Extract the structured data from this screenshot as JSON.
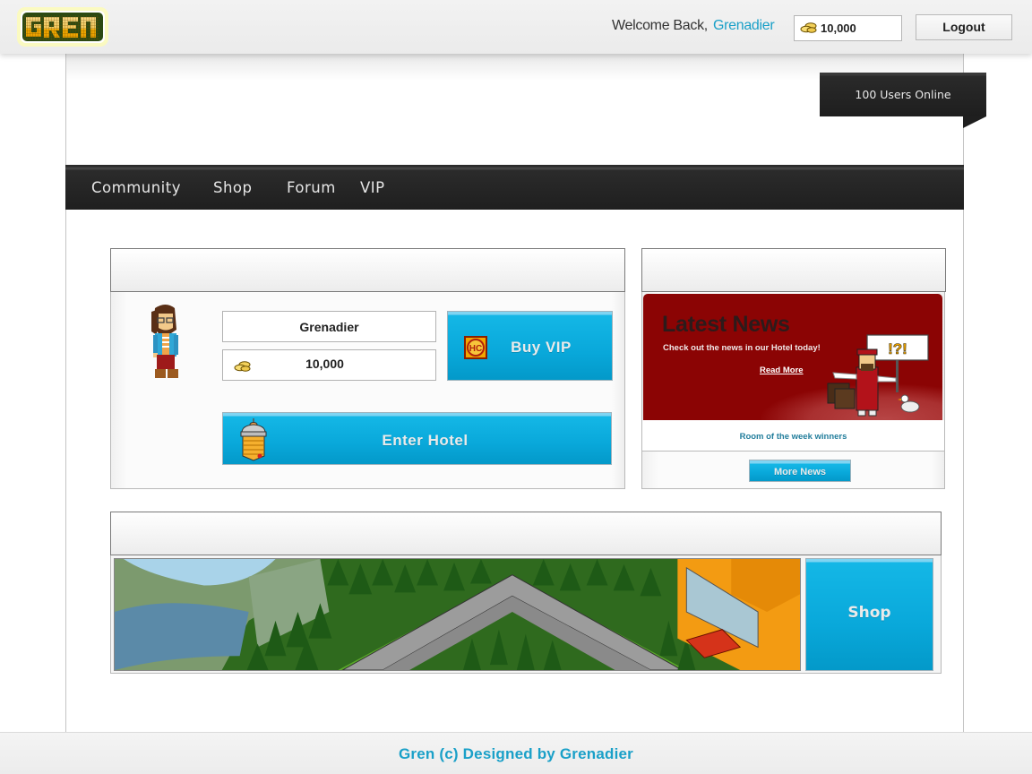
{
  "header": {
    "logo_text": "GREN",
    "welcome_label": "Welcome Back,",
    "username": "Grenadier",
    "credits": "10,000",
    "logout_label": "Logout"
  },
  "status": {
    "users_online": "100 Users Online"
  },
  "nav": {
    "items": [
      {
        "label": "Community"
      },
      {
        "label": "Shop"
      },
      {
        "label": "Forum"
      },
      {
        "label": "VIP"
      }
    ]
  },
  "profile": {
    "name": "Grenadier",
    "credits": "10,000",
    "buy_vip_label": "Buy VIP",
    "enter_hotel_label": "Enter Hotel"
  },
  "news": {
    "title": "Latest News",
    "description": "Check out the news in our Hotel today!",
    "read_more_label": "Read More",
    "sign_text": "!?!",
    "caption": "Room of the week winners",
    "more_news_label": "More News"
  },
  "shop_panel": {
    "shop_label": "Shop"
  },
  "footer": {
    "text": "Gren (c) Designed by Grenadier"
  },
  "colors": {
    "accent_blue": "#1aa0c8",
    "button_blue": "#09a8da",
    "news_red": "#8b0404",
    "nav_dark": "#1f1f1f"
  }
}
